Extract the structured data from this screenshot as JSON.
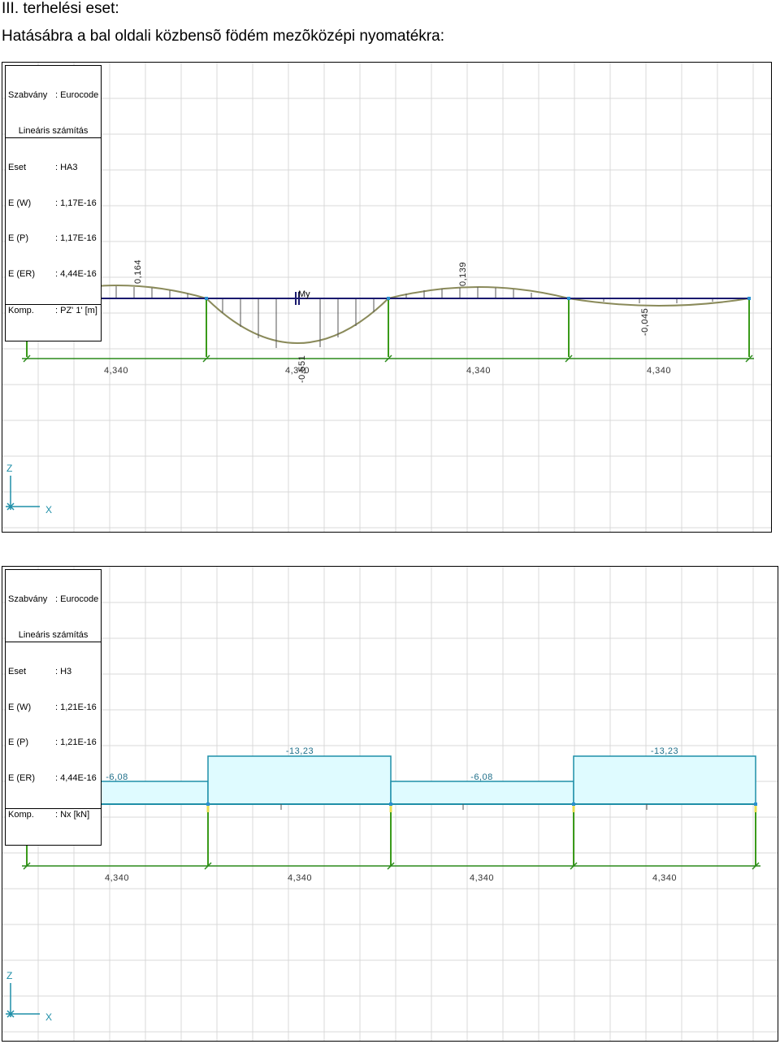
{
  "page": {
    "title_line1": "III. terhelési eset:",
    "title_line2": "Hatásábra a bal oldali közbensõ födém mezõközépi nyomatékra:"
  },
  "panel1": {
    "infobox": {
      "standard_key": "Szabvány",
      "standard_val": ": Eurocode",
      "method": "Lineáris számítás",
      "rows": [
        {
          "k": "Eset",
          "v": ": HA3"
        },
        {
          "k": "E (W)",
          "v": ": 1,17E-16"
        },
        {
          "k": "E (P)",
          "v": ": 1,17E-16"
        },
        {
          "k": "E (ER)",
          "v": ": 4,44E-16"
        }
      ],
      "comp_key": "Komp.",
      "comp_val": ": PZ' 1' [m]"
    },
    "marker_label": "My",
    "value_labels": [
      "0,164",
      "-0,551",
      "0,139",
      "-0,045"
    ],
    "span_labels": [
      "4,340",
      "4,340",
      "4,340",
      "4,340"
    ],
    "axis": {
      "z": "Z",
      "x": "X"
    }
  },
  "panel2": {
    "infobox": {
      "standard_key": "Szabvány",
      "standard_val": ": Eurocode",
      "method": "Lineáris számítás",
      "rows": [
        {
          "k": "Eset",
          "v": ": H3"
        },
        {
          "k": "E (W)",
          "v": ": 1,21E-16"
        },
        {
          "k": "E (P)",
          "v": ": 1,21E-16"
        },
        {
          "k": "E (ER)",
          "v": ": 4,44E-16"
        }
      ],
      "comp_key": "Komp.",
      "comp_val": ": Nx [kN]"
    },
    "value_labels": [
      "-6,08",
      "-13,23",
      "-6,08",
      "-13,23"
    ],
    "span_labels": [
      "4,340",
      "4,340",
      "4,340",
      "4,340"
    ],
    "axis": {
      "z": "Z",
      "x": "X"
    }
  },
  "colors": {
    "grid": "#d9d9d9",
    "beam": "#1a1a6e",
    "influence_line": "#8a8a5a",
    "support": "#3a9a1a",
    "dimension": "#2a8a1a",
    "axis": "#1f8fa8",
    "fill": "#dffbff",
    "fill_stroke": "#1f8fa8",
    "support_yellow": "#e8e050"
  }
}
